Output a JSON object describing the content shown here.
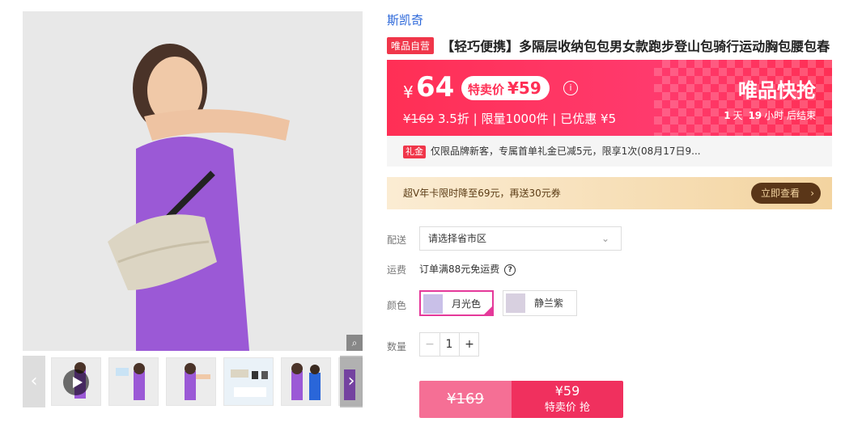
{
  "brand": "斯凯奇",
  "badge": "唯品自营",
  "title": "【轻巧便携】多隔层收纳包包男女款跑步登山包骑行运动胸包腰包春",
  "price": {
    "currency": "¥",
    "main": "64",
    "special_label": "特卖价",
    "special_price": "¥59",
    "original": "¥169",
    "discount": "3.5折",
    "limit": "限量1000件",
    "saved": "已优惠 ¥5",
    "sep": "|"
  },
  "flash": {
    "title": "唯品快抢",
    "days": "1",
    "d_label": "天",
    "hours": "19",
    "h_label": "小时",
    "end_label": "后结束"
  },
  "gift": {
    "tag": "礼金",
    "text": "仅限品牌新客，专属首单礼金已减5元，限享1次(08月17日9..."
  },
  "svip": {
    "text": "超V年卡限时降至69元，再送30元券",
    "button": "立即查看"
  },
  "delivery": {
    "label": "配送",
    "placeholder": "请选择省市区"
  },
  "shipping": {
    "label": "运费",
    "text": "订单满88元免运费"
  },
  "colors": {
    "label": "颜色",
    "options": [
      {
        "name": "月光色",
        "selected": true
      },
      {
        "name": "静兰紫",
        "selected": false
      }
    ]
  },
  "quantity": {
    "label": "数量",
    "minus": "−",
    "value": "1",
    "plus": "+"
  },
  "buy": {
    "original": "¥169",
    "price": "¥59",
    "label": "特卖价 抢"
  },
  "colors_ui": {
    "accent": "#ff2f55",
    "brand_link": "#2a66d9",
    "selected_border": "#e5399a"
  }
}
